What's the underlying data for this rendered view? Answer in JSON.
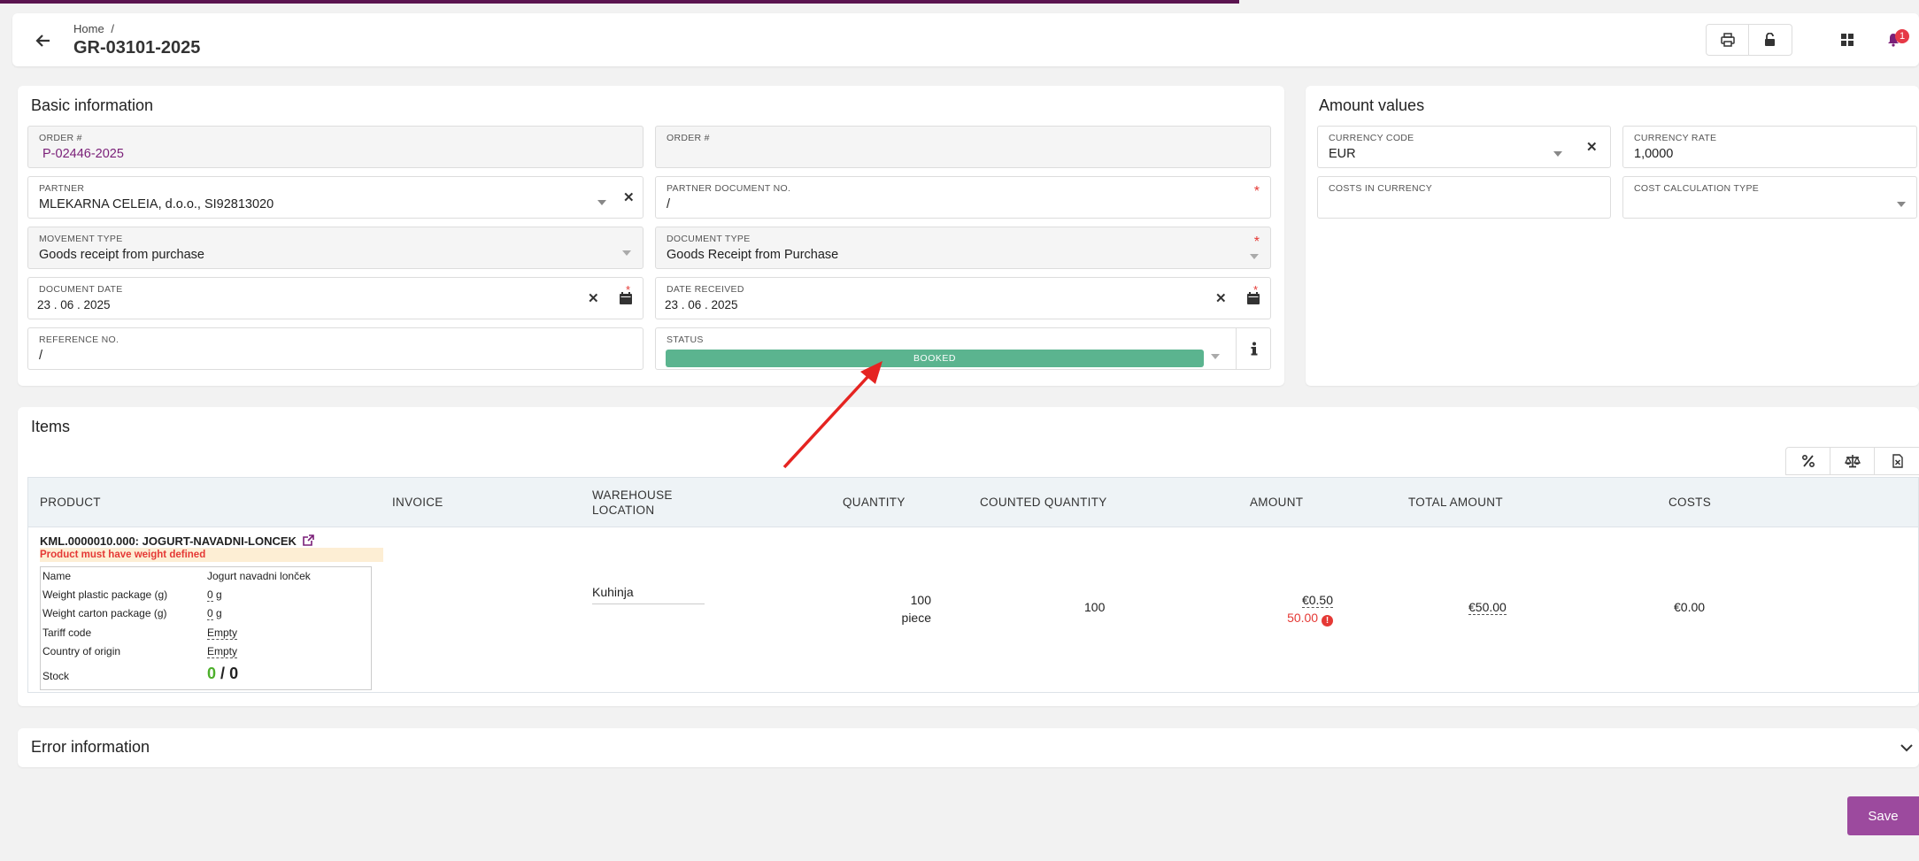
{
  "header": {
    "breadcrumb_home": "Home",
    "breadcrumb_sep": "/",
    "title": "GR-03101-2025",
    "notification_count": "1"
  },
  "basic": {
    "title": "Basic information",
    "order_label": "ORDER #",
    "order_value": "P-02446-2025",
    "order2_label": "ORDER #",
    "partner_label": "PARTNER",
    "partner_value": "MLEKARNA CELEIA, d.o.o., SI92813020",
    "partner_doc_label": "PARTNER DOCUMENT NO.",
    "partner_doc_value": "/",
    "movement_label": "MOVEMENT TYPE",
    "movement_value": "Goods receipt from purchase",
    "doctype_label": "DOCUMENT TYPE",
    "doctype_value": "Goods Receipt from Purchase",
    "docdate_label": "DOCUMENT DATE",
    "docdate_value": "23 . 06 . 2025",
    "datereceived_label": "DATE RECEIVED",
    "datereceived_value": "23 . 06 . 2025",
    "reference_label": "REFERENCE NO.",
    "reference_value": "/",
    "status_label": "STATUS",
    "status_value": "BOOKED"
  },
  "amount": {
    "title": "Amount values",
    "currency_code_label": "CURRENCY CODE",
    "currency_code_value": "EUR",
    "currency_rate_label": "CURRENCY RATE",
    "currency_rate_value": "1,0000",
    "costs_label": "COSTS IN CURRENCY",
    "calc_type_label": "COST CALCULATION TYPE"
  },
  "items": {
    "title": "Items",
    "columns": [
      "PRODUCT",
      "INVOICE",
      "WAREHOUSE",
      "LOCATION",
      "QUANTITY",
      "COUNTED QUANTITY",
      "AMOUNT",
      "TOTAL AMOUNT",
      "COSTS"
    ],
    "row": {
      "product": "KML.0000010.000: JOGURT-NAVADNI-LONCEK",
      "warning": "Product must have weight defined",
      "details": [
        {
          "label": "Name",
          "value": "Jogurt navadni lonček"
        },
        {
          "label": "Weight plastic package (g)",
          "value": "0",
          "unit": "g"
        },
        {
          "label": "Weight carton package (g)",
          "value": "0",
          "unit": "g"
        },
        {
          "label": "Tariff code",
          "value": "Empty"
        },
        {
          "label": "Country of origin",
          "value": "Empty"
        }
      ],
      "stock_label": "Stock",
      "stock_available": "0",
      "stock_sep": "/",
      "stock_total": "0",
      "warehouse": "Kuhinja",
      "quantity": "100",
      "quantity_unit": "piece",
      "counted_quantity": "100",
      "amount": "€0.50",
      "amount_alt": "50.00",
      "total_amount": "€50.00",
      "costs": "€0.00"
    }
  },
  "error": {
    "title": "Error information"
  },
  "save_label": "Save",
  "colors": {
    "brand": "#7a1f78",
    "status_booked": "#5bb48f",
    "save": "#9c4a9e",
    "error": "#e53935"
  }
}
